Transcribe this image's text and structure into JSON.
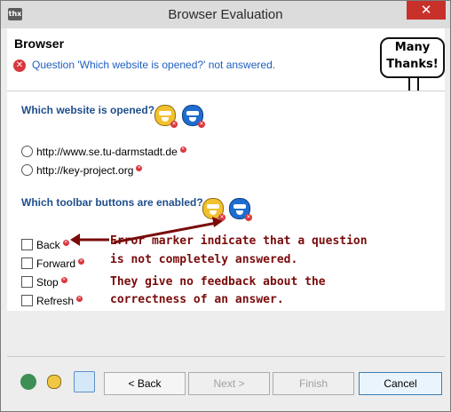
{
  "window": {
    "title": "Browser Evaluation",
    "icon": "thx",
    "close": "✕"
  },
  "header": {
    "title": "Browser",
    "message": "Question 'Which website is opened?' not answered.",
    "badge_line1": "Many",
    "badge_line2": "Thanks!"
  },
  "question1": {
    "title": "Which website is opened?",
    "options": [
      {
        "label": "http://www.se.tu-darmstadt.de"
      },
      {
        "label": "http://key-project.org"
      }
    ]
  },
  "question2": {
    "title": "Which toolbar buttons are enabled?",
    "options": [
      {
        "label": "Back"
      },
      {
        "label": "Forward"
      },
      {
        "label": "Stop"
      },
      {
        "label": "Refresh"
      }
    ]
  },
  "annotation": {
    "line1": "Error marker indicate that a question",
    "line2": "is not completely answered.",
    "line3": "They give no feedback about the",
    "line4": "correctness of an answer."
  },
  "footer": {
    "back": "< Back",
    "next": "Next >",
    "finish": "Finish",
    "cancel": "Cancel"
  },
  "colors": {
    "error": "#d9363e",
    "link_blue": "#1f5fbf",
    "annotation": "#7a0b0b"
  }
}
